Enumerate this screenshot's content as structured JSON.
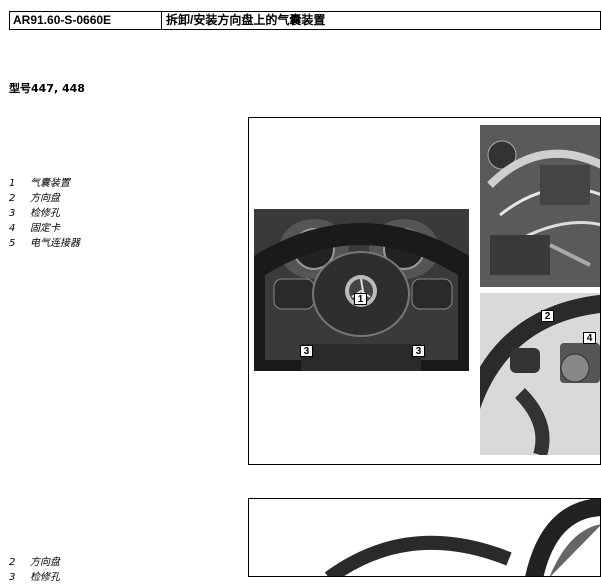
{
  "header": {
    "code": "AR91.60-S-0660E",
    "title": "拆卸/安装方向盘上的气囊装置"
  },
  "model": "型号447, 448",
  "legend1": [
    {
      "num": "1",
      "label": "气囊装置"
    },
    {
      "num": "2",
      "label": "方向盘"
    },
    {
      "num": "3",
      "label": "检修孔"
    },
    {
      "num": "4",
      "label": "固定卡"
    },
    {
      "num": "5",
      "label": "电气连接器"
    }
  ],
  "legend2": [
    {
      "num": "2",
      "label": "方向盘"
    },
    {
      "num": "3",
      "label": "检修孔"
    }
  ],
  "callouts": {
    "c1": "1",
    "c3a": "3",
    "c3b": "3",
    "c2": "2",
    "c4": "4"
  }
}
